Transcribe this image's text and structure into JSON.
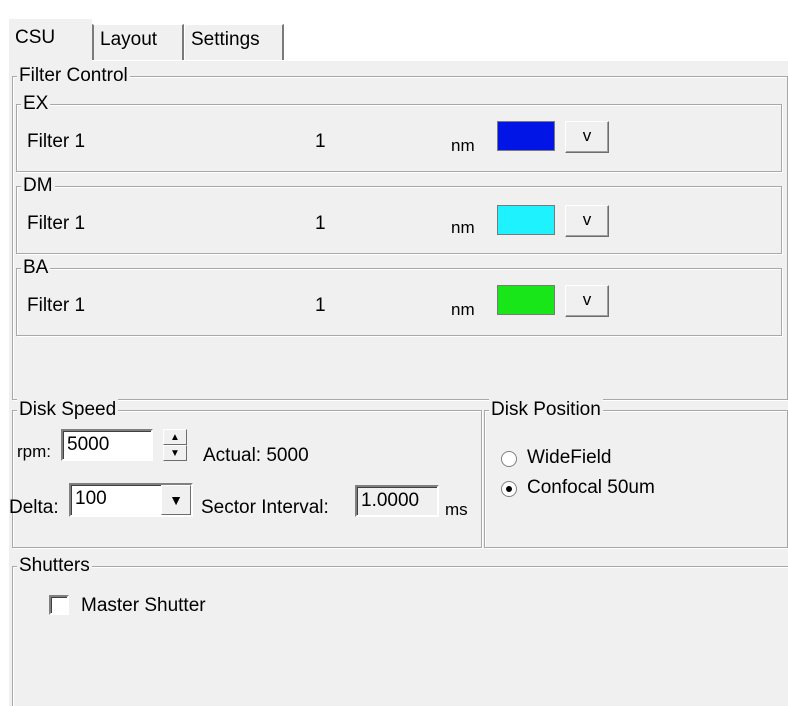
{
  "tabs": [
    {
      "label": "CSU",
      "active": true
    },
    {
      "label": "Layout",
      "active": false
    },
    {
      "label": "Settings",
      "active": false
    }
  ],
  "filter_control": {
    "title": "Filter Control",
    "groups": [
      {
        "title": "EX",
        "filter_name": "Filter 1",
        "value": "1",
        "unit": "nm",
        "color": "#0015e6",
        "button": "v"
      },
      {
        "title": "DM",
        "filter_name": "Filter 1",
        "value": "1",
        "unit": "nm",
        "color": "#1ef2ff",
        "button": "v"
      },
      {
        "title": "BA",
        "filter_name": "Filter 1",
        "value": "1",
        "unit": "nm",
        "color": "#19e619",
        "button": "v"
      }
    ]
  },
  "disk_speed": {
    "title": "Disk Speed",
    "rpm_label": "rpm:",
    "rpm_value": "5000",
    "actual_text": "Actual: 5000",
    "delta_label": "Delta:",
    "delta_value": "100",
    "sector_label": "Sector Interval:",
    "sector_value": "1.0000",
    "sector_unit": "ms"
  },
  "disk_position": {
    "title": "Disk Position",
    "options": [
      {
        "label": "WideField",
        "selected": false
      },
      {
        "label": "Confocal 50um",
        "selected": true
      }
    ]
  },
  "shutters": {
    "title": "Shutters",
    "master_label": "Master Shutter",
    "master_checked": false
  }
}
